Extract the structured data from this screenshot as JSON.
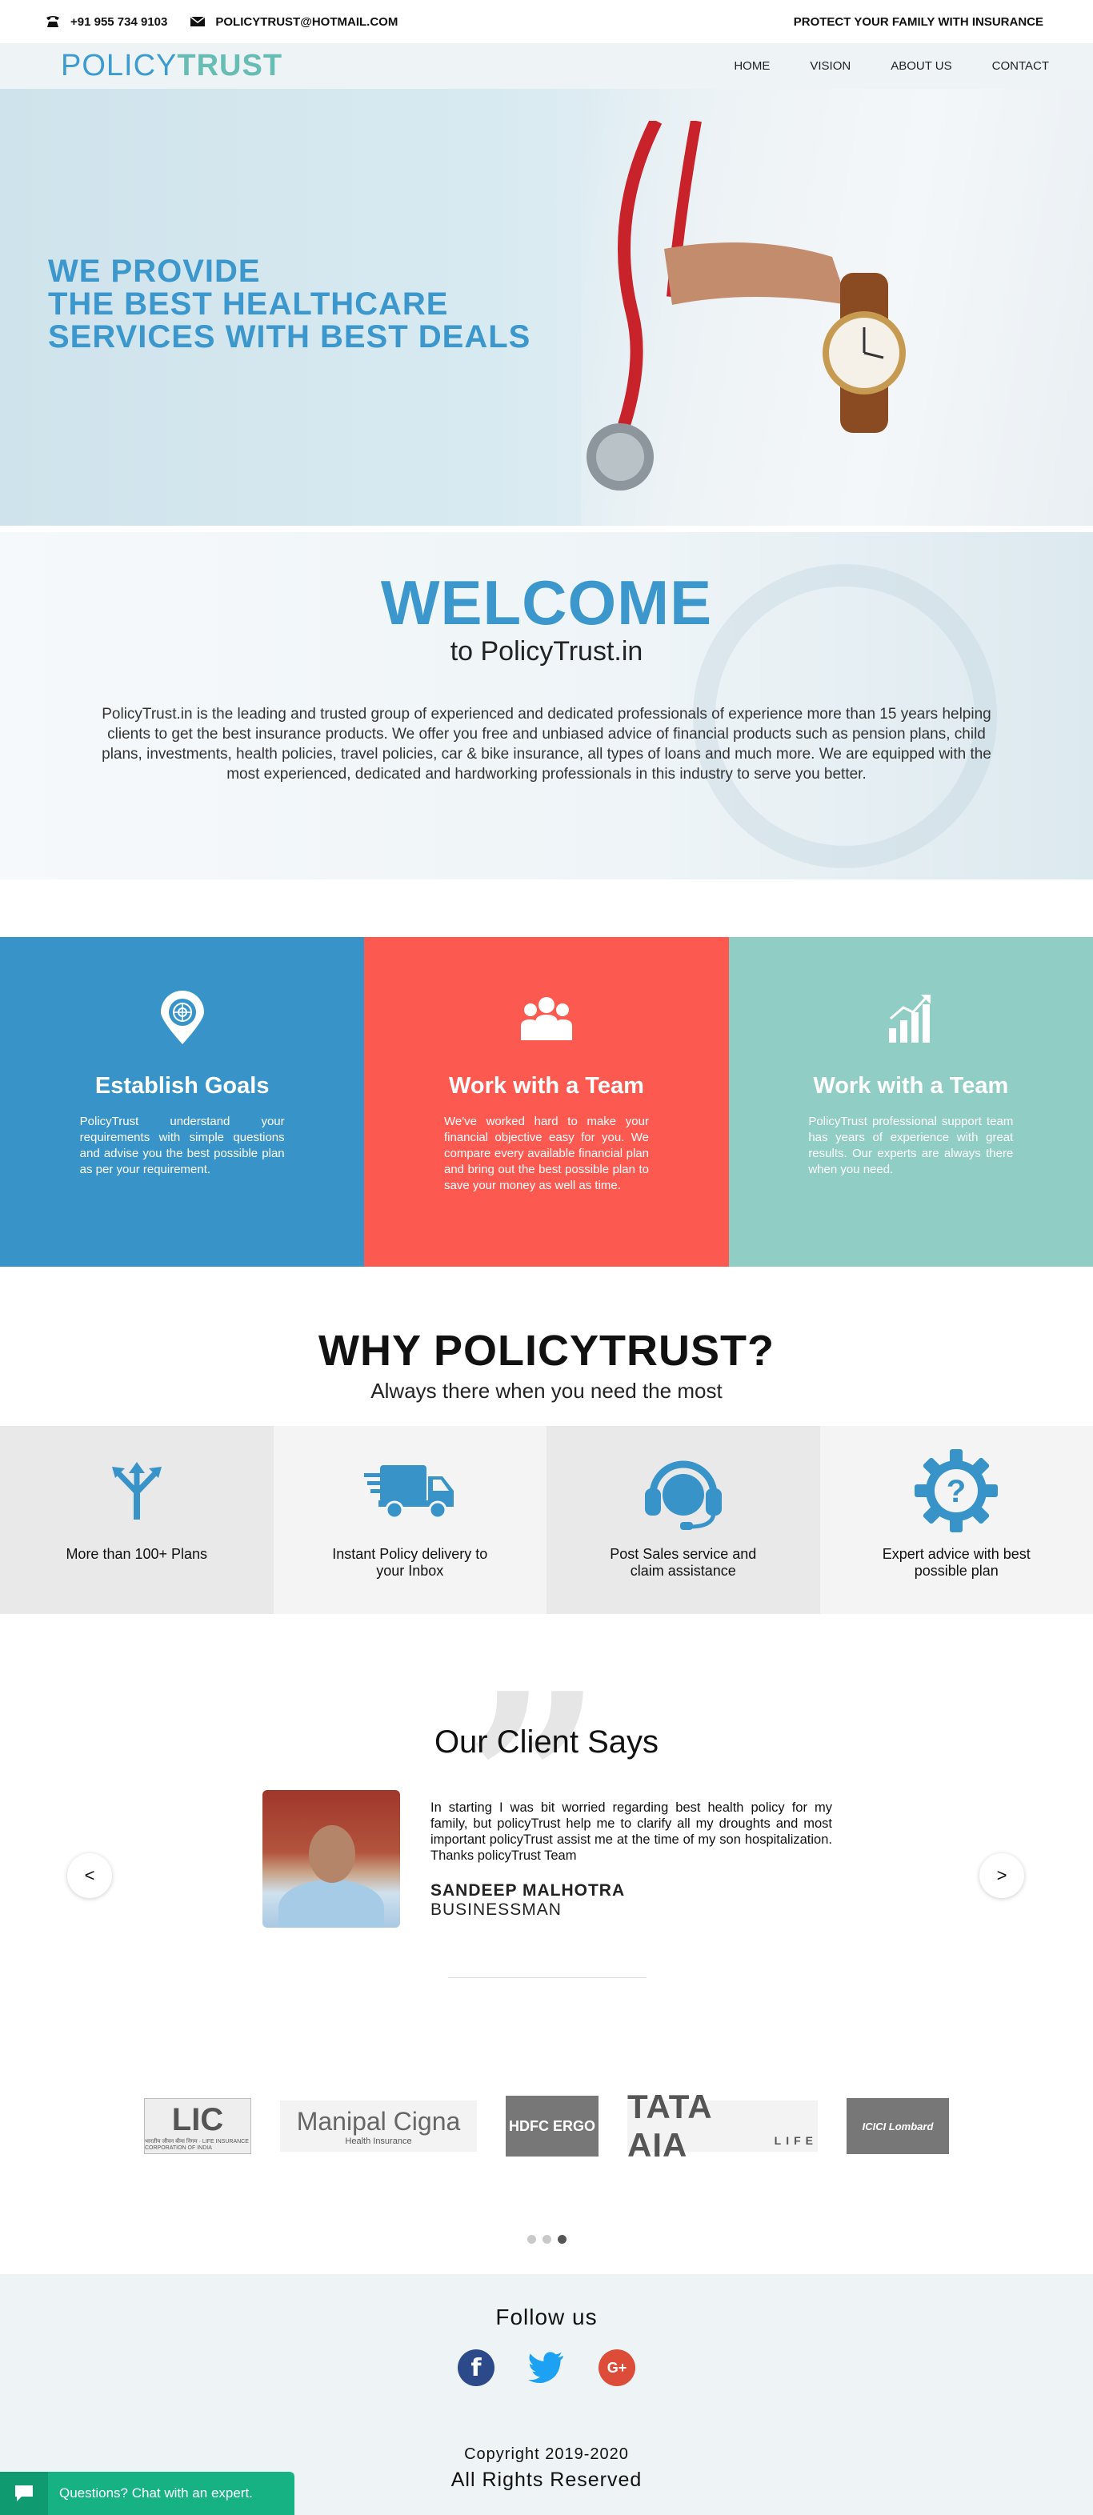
{
  "topbar": {
    "phone": "+91 955 734 9103",
    "email": "POLICYTRUST@HOTMAIL.COM",
    "tagline": "PROTECT YOUR FAMILY WITH INSURANCE"
  },
  "nav": {
    "logo_policy": "POLICY",
    "logo_trust": "TRUST",
    "items": [
      "HOME",
      "VISION",
      "ABOUT US",
      "CONTACT"
    ]
  },
  "hero": {
    "line1": "WE PROVIDE",
    "line2": "THE BEST HEALTHCARE",
    "line3": "SERVICES WITH BEST DEALS"
  },
  "welcome": {
    "title": "WELCOME",
    "subtitle": "to PolicyTrust.in",
    "body": "PolicyTrust.in is the leading and trusted group of experienced and dedicated professionals of experience more than 15 years helping clients to get the best insurance products. We offer you free and unbiased advice of financial products such as pension plans, child plans, investments, health policies, travel policies, car & bike insurance, all types of loans and much more. We are equipped with the most experienced, dedicated and hardworking professionals in this industry to serve you better."
  },
  "features": [
    {
      "title": "Establish Goals",
      "text": "PolicyTrust understand your requirements with simple questions and advise you the best possible plan as per your requirement.",
      "icon": "target-pin-icon"
    },
    {
      "title": "Work with a Team",
      "text": "We've worked hard to make your financial objective easy for you. We compare every available financial plan and bring out the best possible plan to save your money as well as time.",
      "icon": "team-icon"
    },
    {
      "title": "Work with a Team",
      "text": "PolicyTrust professional support team has years of experience with great results. Our experts are always there when you need.",
      "icon": "growth-chart-icon"
    }
  ],
  "why": {
    "title": "WHY POLICYTRUST?",
    "subtitle": "Always there when you need the most",
    "items": [
      {
        "label": "More than 100+ Plans",
        "icon": "split-arrows-icon"
      },
      {
        "label": "Instant Policy delivery to your Inbox",
        "icon": "delivery-truck-icon"
      },
      {
        "label": "Post Sales service and claim assistance",
        "icon": "headset-icon"
      },
      {
        "label": "Expert advice with best possible plan",
        "icon": "question-gear-icon"
      }
    ]
  },
  "testimonial": {
    "title": "Our Client Says",
    "text": "In starting I was bit worried regarding best health policy for my family, but policyTrust help me to clarify all my droughts and most important policyTrust assist me at the time of my son hospitalization. Thanks policyTrust Team",
    "name": "SANDEEP MALHOTRA",
    "role": "BUSINESSMAN",
    "prev": "<",
    "next": ">"
  },
  "partners": {
    "lic": "LIC",
    "lic_sub": "भारतीय जीवन बीमा निगम · LIFE INSURANCE CORPORATION OF INDIA",
    "manipal": "Manipal Cigna",
    "manipal_sub": "Health Insurance",
    "hdfc": "HDFC ERGO",
    "tata": "TATA AIA",
    "tata_sub": "LIFE",
    "icici": "ICICI Lombard"
  },
  "follow": {
    "title": "Follow us",
    "copyright": "Copyright 2019-2020",
    "rights": "All Rights Reserved"
  },
  "chat": {
    "label": "Questions? Chat with an expert."
  },
  "colors": {
    "brand_blue": "#3894c8",
    "coral": "#fc5a50",
    "teal": "#90cdc4",
    "chat_green": "#17b283"
  }
}
